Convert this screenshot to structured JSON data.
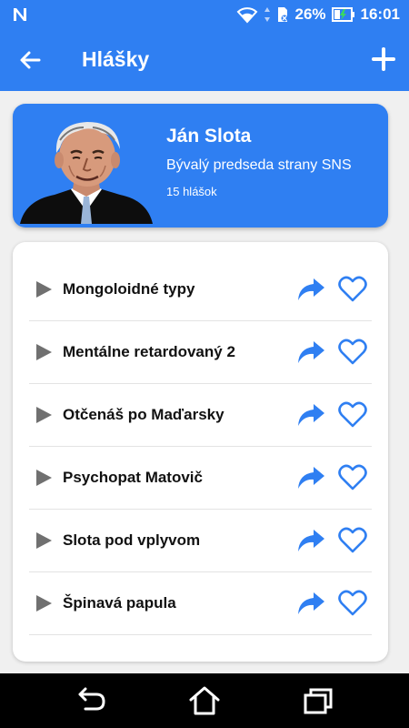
{
  "status_bar": {
    "battery_percent": "26%",
    "time": "16:01",
    "icons": [
      "notification-n-icon",
      "wifi-icon",
      "data-arrows-icon",
      "no-sim-icon",
      "battery-charging-icon"
    ]
  },
  "app_bar": {
    "title": "Hlášky",
    "icons": [
      "back-arrow-icon",
      "plus-icon"
    ]
  },
  "profile": {
    "name": "Ján Slota",
    "description": "Bývalý predseda strany SNS",
    "count": "15 hlášok"
  },
  "quotes": [
    {
      "title": "Mongoloidné typy"
    },
    {
      "title": "Mentálne retardovaný 2"
    },
    {
      "title": "Otčenáš po Maďarsky"
    },
    {
      "title": "Psychopat Matovič"
    },
    {
      "title": "Slota pod vplyvom"
    },
    {
      "title": "Špinavá papula"
    }
  ],
  "item_icons": [
    "play-icon",
    "share-icon",
    "heart-icon"
  ],
  "nav_bar": {
    "icons": [
      "back-icon",
      "home-icon",
      "recent-apps-icon"
    ]
  },
  "colors": {
    "primary": "#2f7ff2",
    "background": "#f0f0f0",
    "play": "#707070",
    "text": "#111111"
  }
}
